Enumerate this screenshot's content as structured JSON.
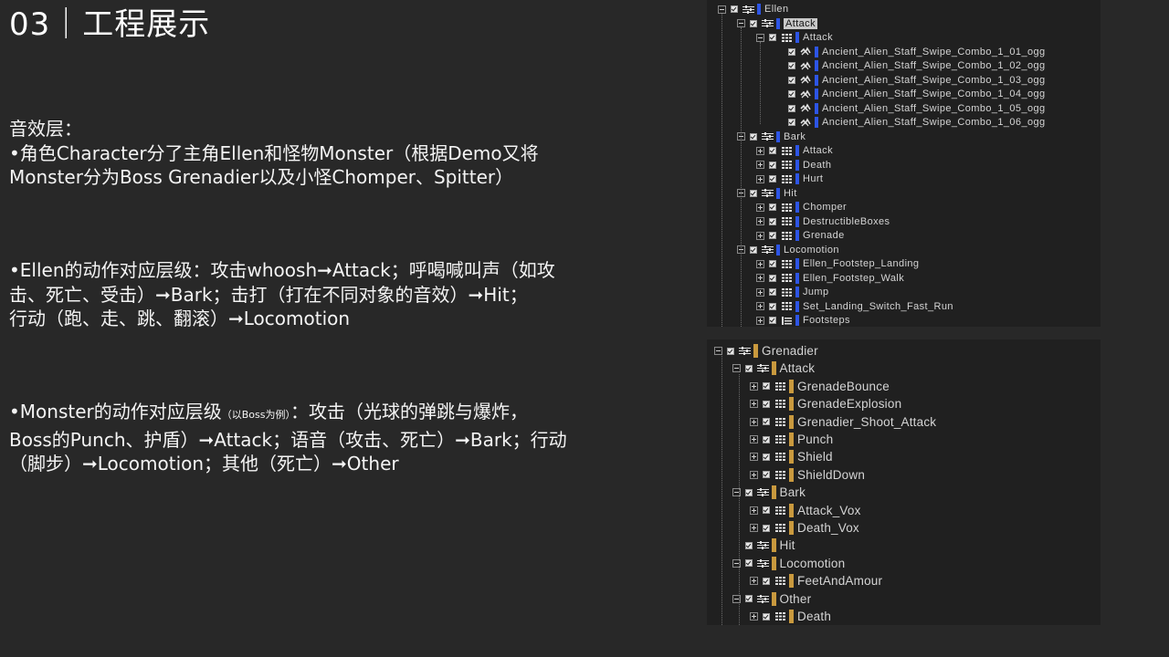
{
  "slide": {
    "title": "03｜工程展示"
  },
  "paragraphs": {
    "p1_l1": "音效层：",
    "p1_l2": "•角色Character分了主角Ellen和怪物Monster（根据Demo又将",
    "p1_l3": "Monster分为Boss Grenadier以及小怪Chomper、Spitter）",
    "p2_l1": "•Ellen的动作对应层级：攻击whoosh➞Attack；呼喝喊叫声（如攻",
    "p2_l2": "击、死亡、受击）➞Bark；击打（打在不同对象的音效）➞Hit；",
    "p2_l3": "行动（跑、走、跳、翻滚）➞Locomotion",
    "p3_l1a": "•Monster的动作对应层级",
    "p3_l1small": "（以Boss为例）",
    "p3_l1b": "：攻击（光球的弹跳与爆炸，",
    "p3_l2": "Boss的Punch、护盾）➞Attack；语音（攻击、死亡）➞Bark；行动",
    "p3_l3": "（脚步）➞Locomotion；其他（死亡）➞Other"
  },
  "colors": {
    "ellen_accent": "#2d55e6",
    "grenadier_accent": "#c9993e",
    "bg": "#282828",
    "panel": "#202020"
  },
  "ellen_tree": [
    {
      "label": "Ellen",
      "toggle": "minus",
      "icon": "actor-mixer-icon"
    },
    {
      "label": "Attack",
      "toggle": "minus",
      "icon": "actor-mixer-icon",
      "selected": true
    },
    {
      "label": "Attack",
      "toggle": "minus",
      "icon": "random-container-icon"
    },
    {
      "label": "Ancient_Alien_Staff_Swipe_Combo_1_01_ogg",
      "toggle": "none",
      "icon": "sound-icon"
    },
    {
      "label": "Ancient_Alien_Staff_Swipe_Combo_1_02_ogg",
      "toggle": "none",
      "icon": "sound-icon"
    },
    {
      "label": "Ancient_Alien_Staff_Swipe_Combo_1_03_ogg",
      "toggle": "none",
      "icon": "sound-icon"
    },
    {
      "label": "Ancient_Alien_Staff_Swipe_Combo_1_04_ogg",
      "toggle": "none",
      "icon": "sound-icon"
    },
    {
      "label": "Ancient_Alien_Staff_Swipe_Combo_1_05_ogg",
      "toggle": "none",
      "icon": "sound-icon"
    },
    {
      "label": "Ancient_Alien_Staff_Swipe_Combo_1_06_ogg",
      "toggle": "none",
      "icon": "sound-icon"
    },
    {
      "label": "Bark",
      "toggle": "minus",
      "icon": "actor-mixer-icon"
    },
    {
      "label": "Attack",
      "toggle": "plus",
      "icon": "random-container-icon"
    },
    {
      "label": "Death",
      "toggle": "plus",
      "icon": "random-container-icon"
    },
    {
      "label": "Hurt",
      "toggle": "plus",
      "icon": "random-container-icon"
    },
    {
      "label": "Hit",
      "toggle": "minus",
      "icon": "actor-mixer-icon"
    },
    {
      "label": "Chomper",
      "toggle": "plus",
      "icon": "random-container-icon"
    },
    {
      "label": "DestructibleBoxes",
      "toggle": "plus",
      "icon": "random-container-icon"
    },
    {
      "label": "Grenade",
      "toggle": "plus",
      "icon": "random-container-icon"
    },
    {
      "label": "Locomotion",
      "toggle": "minus",
      "icon": "actor-mixer-icon"
    },
    {
      "label": "Ellen_Footstep_Landing",
      "toggle": "plus",
      "icon": "random-container-icon"
    },
    {
      "label": "Ellen_Footstep_Walk",
      "toggle": "plus",
      "icon": "random-container-icon"
    },
    {
      "label": "Jump",
      "toggle": "plus",
      "icon": "random-container-icon"
    },
    {
      "label": "Set_Landing_Switch_Fast_Run",
      "toggle": "plus",
      "icon": "random-container-icon"
    },
    {
      "label": "Footsteps",
      "toggle": "plus",
      "icon": "switch-container-icon"
    }
  ],
  "grenadier_tree": [
    {
      "label": "Grenadier",
      "toggle": "minus",
      "icon": "actor-mixer-icon"
    },
    {
      "label": "Attack",
      "toggle": "minus",
      "icon": "actor-mixer-icon"
    },
    {
      "label": "GrenadeBounce",
      "toggle": "plus",
      "icon": "random-container-icon"
    },
    {
      "label": "GrenadeExplosion",
      "toggle": "plus",
      "icon": "random-container-icon"
    },
    {
      "label": "Grenadier_Shoot_Attack",
      "toggle": "plus",
      "icon": "random-container-icon"
    },
    {
      "label": "Punch",
      "toggle": "plus",
      "icon": "random-container-icon"
    },
    {
      "label": "Shield",
      "toggle": "plus",
      "icon": "random-container-icon"
    },
    {
      "label": "ShieldDown",
      "toggle": "plus",
      "icon": "random-container-icon"
    },
    {
      "label": "Bark",
      "toggle": "minus",
      "icon": "actor-mixer-icon"
    },
    {
      "label": "Attack_Vox",
      "toggle": "plus",
      "icon": "random-container-icon"
    },
    {
      "label": "Death_Vox",
      "toggle": "plus",
      "icon": "random-container-icon"
    },
    {
      "label": "Hit",
      "toggle": "none",
      "icon": "actor-mixer-icon"
    },
    {
      "label": "Locomotion",
      "toggle": "minus",
      "icon": "actor-mixer-icon"
    },
    {
      "label": "FeetAndAmour",
      "toggle": "plus",
      "icon": "random-container-icon"
    },
    {
      "label": "Other",
      "toggle": "minus",
      "icon": "actor-mixer-icon"
    },
    {
      "label": "Death",
      "toggle": "plus",
      "icon": "random-container-icon"
    }
  ]
}
